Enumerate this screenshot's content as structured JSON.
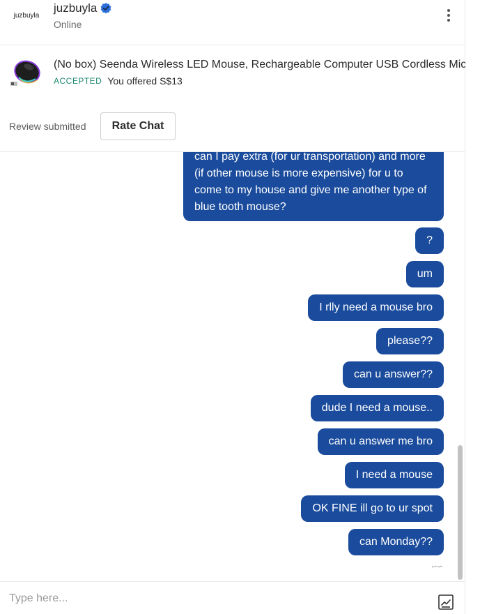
{
  "header": {
    "avatar_text": "juzbuyla",
    "username": "juzbuyla",
    "status": "Online"
  },
  "listing": {
    "title": "(No box) Seenda Wireless LED Mouse, Rechargeable Computer USB Cordless Mice M",
    "status_badge": "ACCEPTED",
    "offer_text": "You offered S$13"
  },
  "review": {
    "status_text": "Review submitted",
    "rate_button": "Rate Chat"
  },
  "messages": [
    {
      "text": "can I pay extra (for ur transportation) and more (if other mouse is more expensive) for u to come to my house and give me another type of blue tooth mouse?"
    },
    {
      "text": "?"
    },
    {
      "text": "um"
    },
    {
      "text": "I rlly need a mouse bro"
    },
    {
      "text": "please??"
    },
    {
      "text": "can u answer??"
    },
    {
      "text": "dude I need a mouse.."
    },
    {
      "text": "can u answer me bro"
    },
    {
      "text": "I need a mouse"
    },
    {
      "text": "OK FINE ill go to ur spot"
    },
    {
      "text": "can Monday??"
    }
  ],
  "seen_label": "juzbuyla",
  "composer": {
    "placeholder": "Type here..."
  },
  "colors": {
    "bubble": "#1a4b9c",
    "accepted": "#1f8a70",
    "verified": "#2a6fdb"
  },
  "icons": [
    "verified-badge-icon",
    "more-vertical-icon",
    "send-image-icon"
  ]
}
